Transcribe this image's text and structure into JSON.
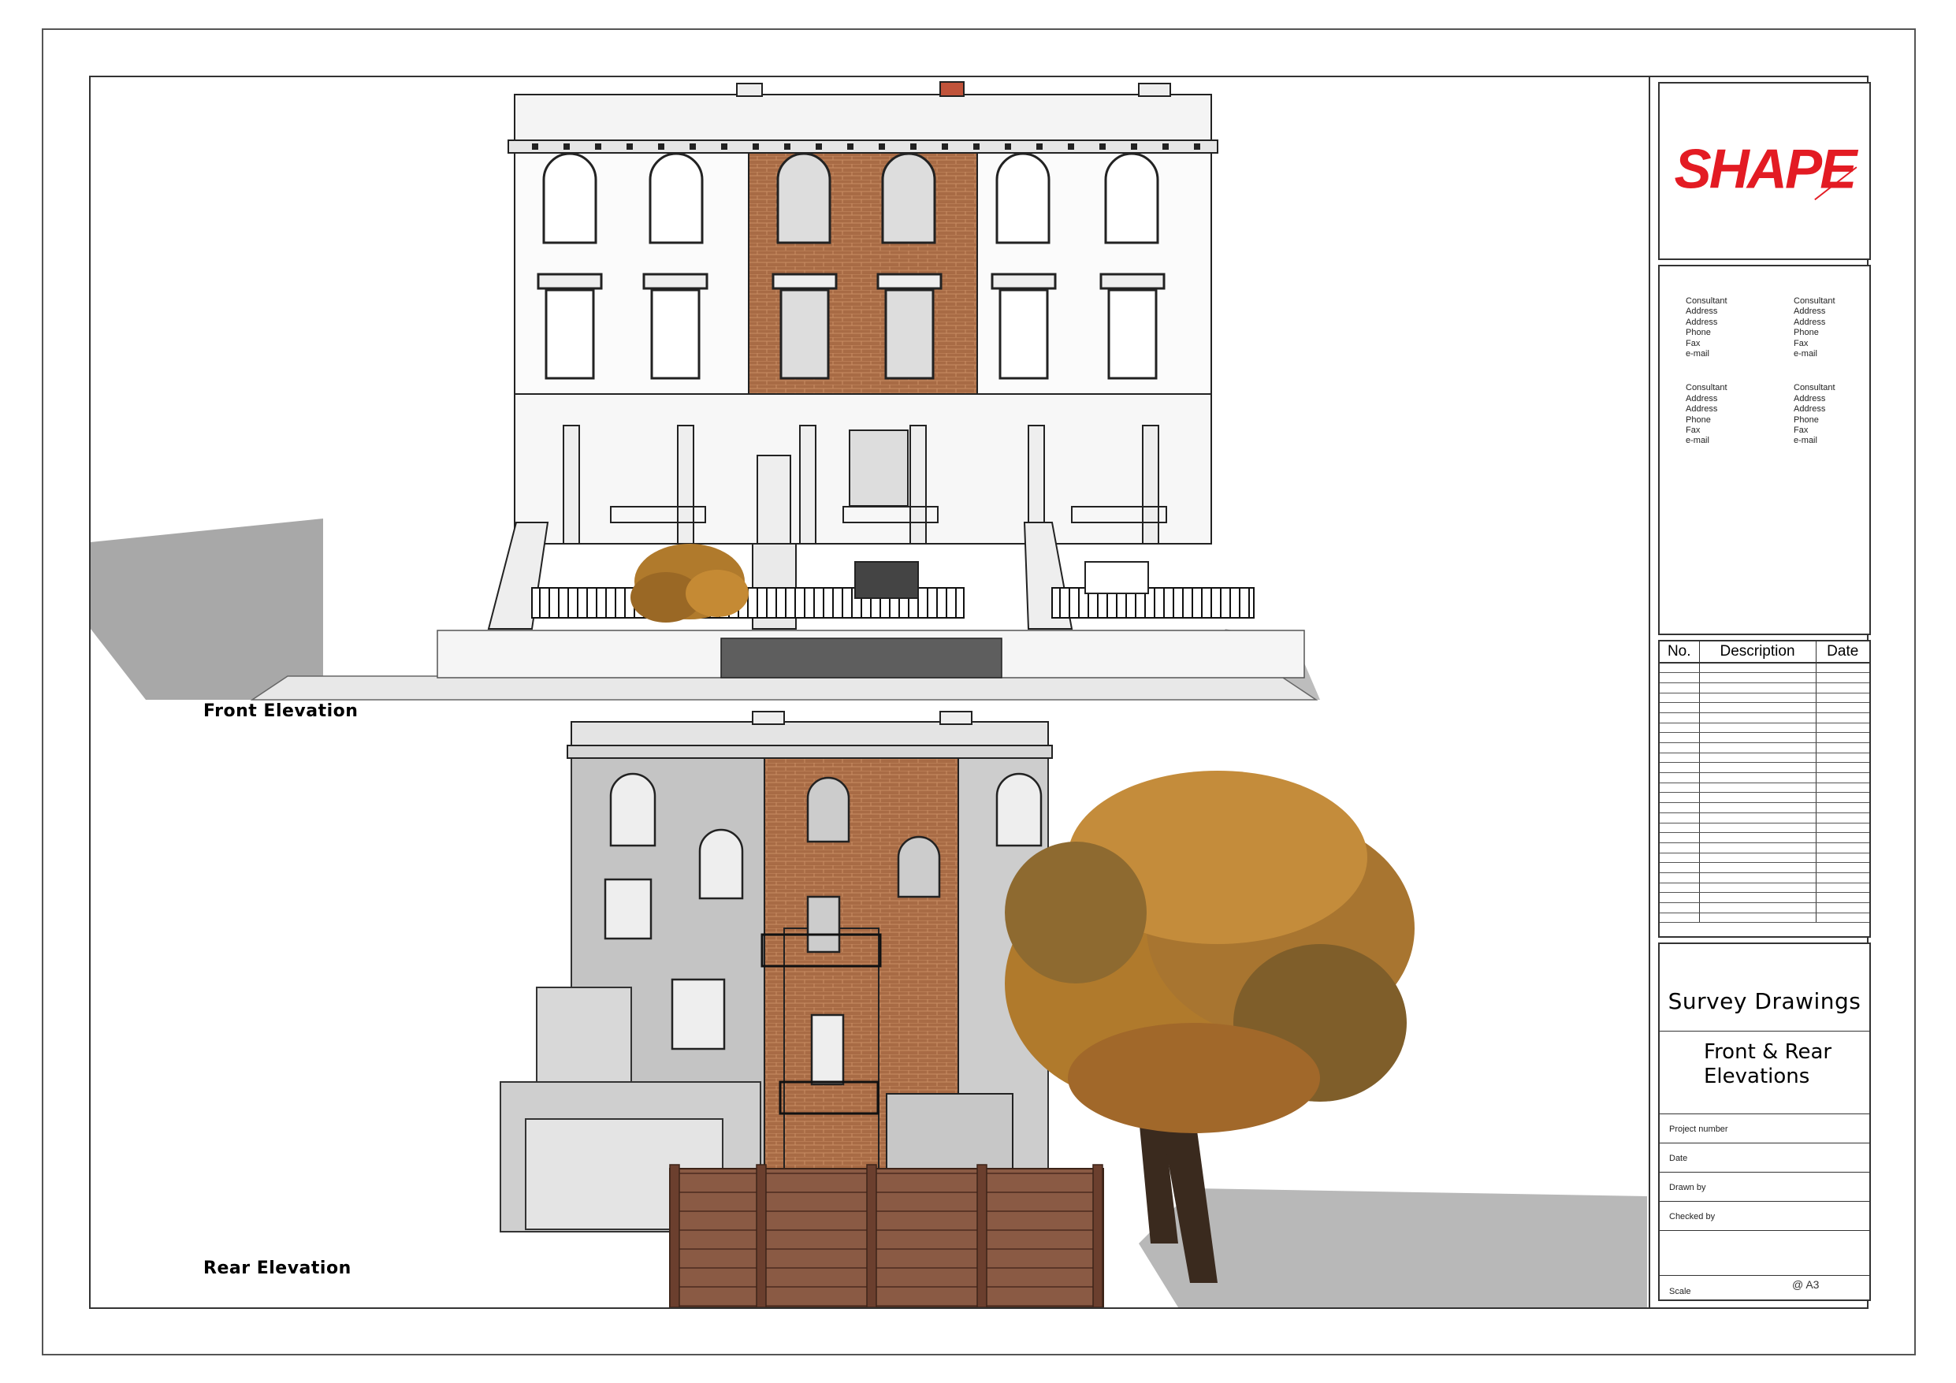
{
  "views": {
    "front_label": "Front Elevation",
    "rear_label": "Rear Elevation"
  },
  "title_block": {
    "logo_text": "SHAPE",
    "logo_color": "#e31b23",
    "consultants": [
      {
        "lines": [
          "Consultant",
          "Address",
          "Address",
          "Phone",
          "Fax",
          "e-mail"
        ]
      },
      {
        "lines": [
          "Consultant",
          "Address",
          "Address",
          "Phone",
          "Fax",
          "e-mail"
        ]
      },
      {
        "lines": [
          "Consultant",
          "Address",
          "Address",
          "Phone",
          "Fax",
          "e-mail"
        ]
      },
      {
        "lines": [
          "Consultant",
          "Address",
          "Address",
          "Phone",
          "Fax",
          "e-mail"
        ]
      }
    ],
    "revisions": {
      "headers": [
        "No.",
        "Description",
        "Date"
      ]
    },
    "title": "Survey Drawings",
    "subtitle_lines": [
      "Front & Rear",
      "Elevations"
    ],
    "fields": {
      "project_number": "Project number",
      "date": "Date",
      "drawn_by": "Drawn by",
      "checked_by": "Checked by",
      "scale": "Scale",
      "scale_value": "@ A3"
    }
  },
  "colors": {
    "brick": "#a86b45",
    "render_white": "#fbfbfb",
    "render_grey": "#c4c4c4",
    "shadow": "#a8a8a8",
    "fence": "#8a5a44",
    "foliage": "#b07a2c"
  }
}
